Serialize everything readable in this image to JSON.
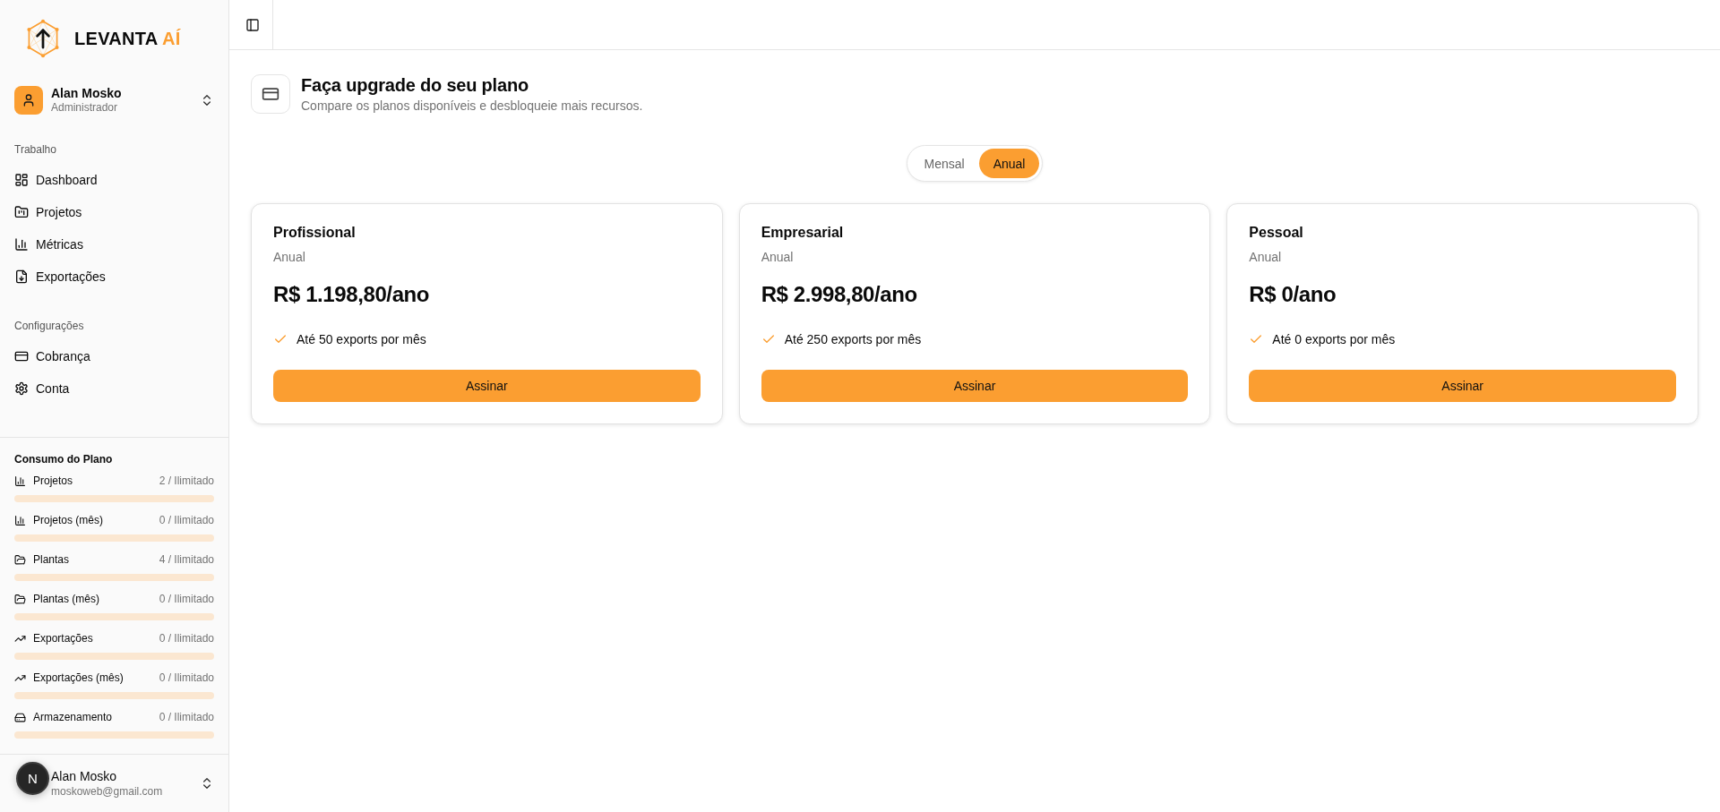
{
  "logo": {
    "text": "LEVANTA",
    "accent": "AÍ"
  },
  "account": {
    "name": "Alan Mosko",
    "role": "Administrador"
  },
  "nav_groups": [
    {
      "label": "Trabalho",
      "items": [
        {
          "label": "Dashboard",
          "selected": false
        },
        {
          "label": "Projetos",
          "selected": false
        },
        {
          "label": "Métricas",
          "selected": false
        },
        {
          "label": "Exportações",
          "selected": false
        }
      ]
    },
    {
      "label": "Configurações",
      "items": [
        {
          "label": "Cobrança",
          "selected": false
        },
        {
          "label": "Conta",
          "selected": false
        }
      ]
    }
  ],
  "usage": {
    "title": "Consumo do Plano",
    "rows": [
      {
        "label": "Projetos",
        "count": "2 / Ilimitado",
        "level": 0
      },
      {
        "label": "Projetos (mês)",
        "count": "0 / Ilimitado",
        "level": 0
      },
      {
        "label": "Plantas",
        "count": "4 / Ilimitado",
        "level": 0
      },
      {
        "label": "Plantas (mês)",
        "count": "0 / Ilimitado",
        "level": 0
      },
      {
        "label": "Exportações",
        "count": "0 / Ilimitado",
        "level": 0
      },
      {
        "label": "Exportações (mês)",
        "count": "0 / Ilimitado",
        "level": 0
      },
      {
        "label": "Armazenamento",
        "count": "0 / Ilimitado",
        "level": 0
      }
    ]
  },
  "footer_user": {
    "name": "Alan Mosko",
    "email": "moskoweb@gmail.com"
  },
  "dev_badge": {
    "text": "N"
  },
  "page_header": {
    "title": "Faça upgrade do seu plano",
    "subtitle": "Compare os planos disponíveis e desbloqueie mais recursos."
  },
  "billing_toggle": [
    {
      "label": "Mensal",
      "selected": false
    },
    {
      "label": "Anual",
      "selected": true
    }
  ],
  "plans": [
    {
      "name": "Profissional",
      "period": "Anual",
      "price": "R$ 1.198,80/ano",
      "features": [
        "Até 50 exports por mês"
      ],
      "button": "Assinar"
    },
    {
      "name": "Empresarial",
      "period": "Anual",
      "price": "R$ 2.998,80/ano",
      "features": [
        "Até 250 exports por mês"
      ],
      "button": "Assinar"
    },
    {
      "name": "Pessoal",
      "period": "Anual",
      "price": "R$ 0/ano",
      "features": [
        "Até 0 exports por mês"
      ],
      "button": "Assinar"
    }
  ]
}
